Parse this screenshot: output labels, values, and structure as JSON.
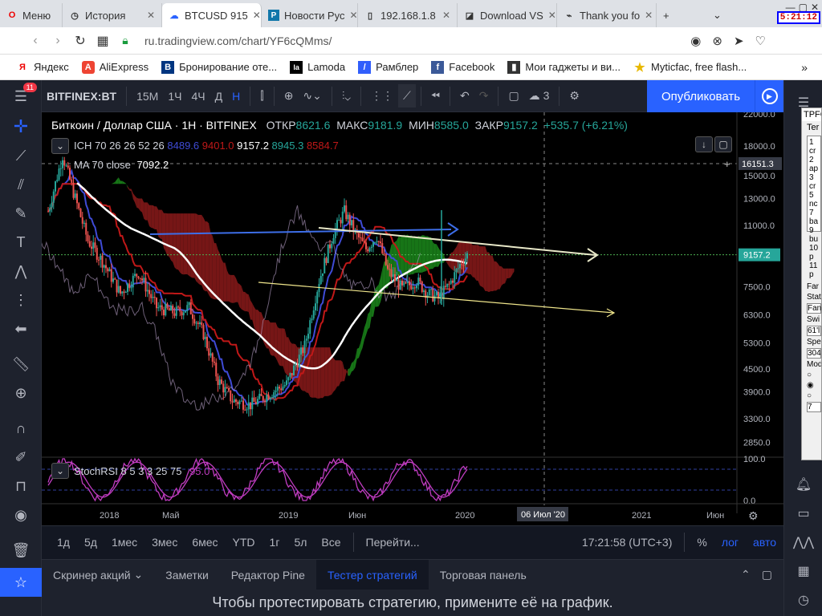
{
  "browser": {
    "tabs": [
      {
        "icon": "O",
        "label": "Меню",
        "color": "#e00"
      },
      {
        "icon": "◷",
        "label": "История",
        "color": "#555"
      },
      {
        "icon": "☁",
        "label": "BTCUSD 915",
        "color": "#2962ff",
        "active": true
      },
      {
        "icon": "P",
        "label": "Новости Рус",
        "color": "#0a4"
      },
      {
        "icon": "▯",
        "label": "192.168.1.8",
        "color": "#555"
      },
      {
        "icon": "◪",
        "label": "Download VS",
        "color": "#555"
      },
      {
        "icon": "⌁",
        "label": "Thank you fo",
        "color": "#555"
      }
    ],
    "clock": "5:21:12",
    "url": "ru.tradingview.com/chart/YF6cQMms/",
    "bookmarks": [
      {
        "label": "Яндекс",
        "icon": "Я",
        "color": "#e00"
      },
      {
        "label": "AliExpress",
        "icon": "A",
        "color": "#e43"
      },
      {
        "label": "Бронирование оте...",
        "icon": "B",
        "color": "#003580"
      },
      {
        "label": "Lamoda",
        "icon": "la",
        "color": "#000"
      },
      {
        "label": "Рамблер",
        "icon": "/",
        "color": "#315efb"
      },
      {
        "label": "Facebook",
        "icon": "f",
        "color": "#3b5998"
      },
      {
        "label": "Мои гаджеты и ви...",
        "icon": "▮",
        "color": "#333"
      },
      {
        "label": "Myticfac, free flash...",
        "icon": "★",
        "color": "#e8b800"
      }
    ]
  },
  "toolbar": {
    "symbol": "BITFINEX:BT",
    "intervals": [
      "15М",
      "1Ч",
      "4Ч",
      "Д",
      "Н"
    ],
    "active_interval": "Н",
    "layout_count": "3",
    "publish": "Опубликовать",
    "badge": "11"
  },
  "legend": {
    "title": "Биткоин / Доллар США · 1H · BITFINEX",
    "o_label": "ОТКР",
    "o": "8621.6",
    "h_label": "МАКС",
    "h": "9181.9",
    "l_label": "МИН",
    "l": "8585.0",
    "c_label": "ЗАКР",
    "c": "9157.2",
    "change": "+535.7 (+6.21%)",
    "ich_name": "ICH 70 26 26 52 26",
    "ich_v1": "8489.6",
    "ich_v2": "9401.0",
    "ich_v3": "9157.2",
    "ich_v4": "8945.3",
    "ich_v5": "8584.7",
    "ma_name": "MA 70 close",
    "ma_v": "7092.2",
    "stoch_name": "StochRSI 8 5 3 3 25 75",
    "stoch_v": "95.0"
  },
  "price_axis": {
    "ticks": [
      "22000.0",
      "18000.0",
      "15000.0",
      "13000.0",
      "11000.0",
      "7500.0",
      "6300.0",
      "5300.0",
      "4500.0",
      "3900.0",
      "3300.0",
      "2850.0"
    ],
    "current": "9157.2",
    "crosshair": "16151.3",
    "stoch_ticks": [
      "100.0",
      "0.0"
    ]
  },
  "time_axis": {
    "ticks": [
      "2018",
      "Май",
      "2019",
      "Июн",
      "2020",
      "2021",
      "Июн"
    ],
    "crosshair": "06 Июл '20"
  },
  "range_bar": {
    "items": [
      "1д",
      "5д",
      "1мес",
      "3мес",
      "6мес",
      "YTD",
      "1г",
      "5л",
      "Все"
    ],
    "goto": "Перейти...",
    "time": "17:21:58 (UTC+3)",
    "pct": "%",
    "log": "лог",
    "auto": "авто"
  },
  "bottom_tabs": [
    "Скринер акций",
    "Заметки",
    "Редактор Pine",
    "Тестер стратегий",
    "Торговая панель"
  ],
  "active_bottom_tab": "Тестер стратегий",
  "bottom_message": "Чтобы протестировать стратегию, примените её на график.",
  "popup": {
    "title": "TPFC",
    "lines": [
      "Ter",
      "1 cr",
      "2 ap",
      "3 cr",
      "5 nc",
      "7 ba",
      "9 bu",
      "10 p",
      "11 p"
    ],
    "fields": [
      "Far",
      "Stat",
      "Fan",
      "Swi",
      "61'l",
      "Spe",
      "304",
      "Mod",
      "7"
    ]
  },
  "colors": {
    "up": "#26a69a",
    "down": "#ef5350",
    "accent": "#2962ff",
    "ma": "#ffffff",
    "cloud_up": "#1b8a1b",
    "cloud_down": "#8b1a1a",
    "tenkan": "#3f4bd6",
    "kijun": "#c01818"
  }
}
